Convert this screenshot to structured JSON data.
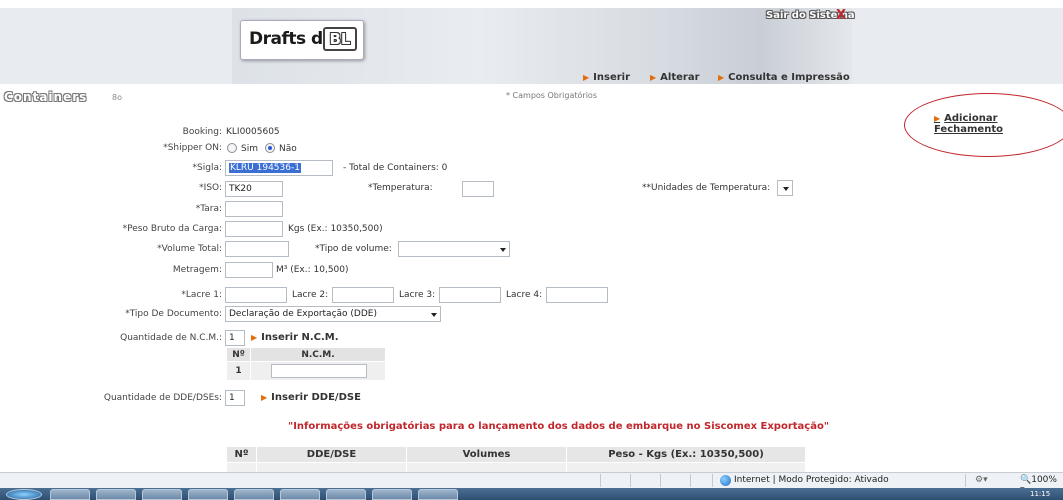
{
  "header": {
    "logo_text": "Drafts de",
    "logo_box": "BL",
    "logout": "Sair do Sistema",
    "logout_icon": "X",
    "nav": [
      "Inserir",
      "Alterar",
      "Consulta e Impressão"
    ]
  },
  "page": {
    "title": "Containers",
    "title_sub": "8o",
    "required_note": "* Campos Obrigatórios",
    "add_closing": "Adicionar Fechamento"
  },
  "form": {
    "booking_label": "Booking:",
    "booking_value": "KLI0005605",
    "shipper_label": "*Shipper ON:",
    "shipper_yes": "Sim",
    "shipper_no": "Não",
    "sigla_label": "*Sigla:",
    "sigla_value": "KLRU 194536-1",
    "total_containers": "- Total de Containers: 0",
    "iso_label": "*ISO:",
    "iso_value": "TK20",
    "temp_label": "*Temperatura:",
    "temp_units_label": "**Unidades de Temperatura:",
    "tara_label": "*Tara:",
    "peso_label": "*Peso Bruto da Carga:",
    "peso_hint": "Kgs (Ex.: 10350,500)",
    "volume_label": "*Volume Total:",
    "tipo_volume_label": "*Tipo de volume:",
    "metragem_label": "Metragem:",
    "metragem_hint": "M³ (Ex.: 10,500)",
    "lacre1_label": "*Lacre 1:",
    "lacre2_label": "Lacre 2:",
    "lacre3_label": "Lacre 3:",
    "lacre4_label": "Lacre 4:",
    "tipo_doc_label": "*Tipo De Documento:",
    "tipo_doc_value": "Declaração de Exportação (DDE)",
    "qtd_ncm_label": "Quantidade de N.C.M.:",
    "qtd_ncm_value": "1",
    "inserir_ncm": "Inserir N.C.M.",
    "qtd_dde_label": "Quantidade de DDE/DSEs:",
    "qtd_dde_value": "1",
    "inserir_dde": "Inserir DDE/DSE"
  },
  "ncm_table": {
    "headers": [
      "Nº",
      "N.C.M."
    ],
    "row_num": "1"
  },
  "siscomex_title": "\"Informações obrigatórias para o lançamento dos dados de embarque no Siscomex Exportação\"",
  "dde_table": {
    "headers": [
      "Nº",
      "DDE/DSE",
      "Volumes",
      "Peso - Kgs (Ex.: 10350,500)"
    ]
  },
  "status_bar": {
    "zone": "Internet | Modo Protegido: Ativado",
    "zoom": "100%"
  },
  "taskbar": {
    "clock": "11:15"
  }
}
